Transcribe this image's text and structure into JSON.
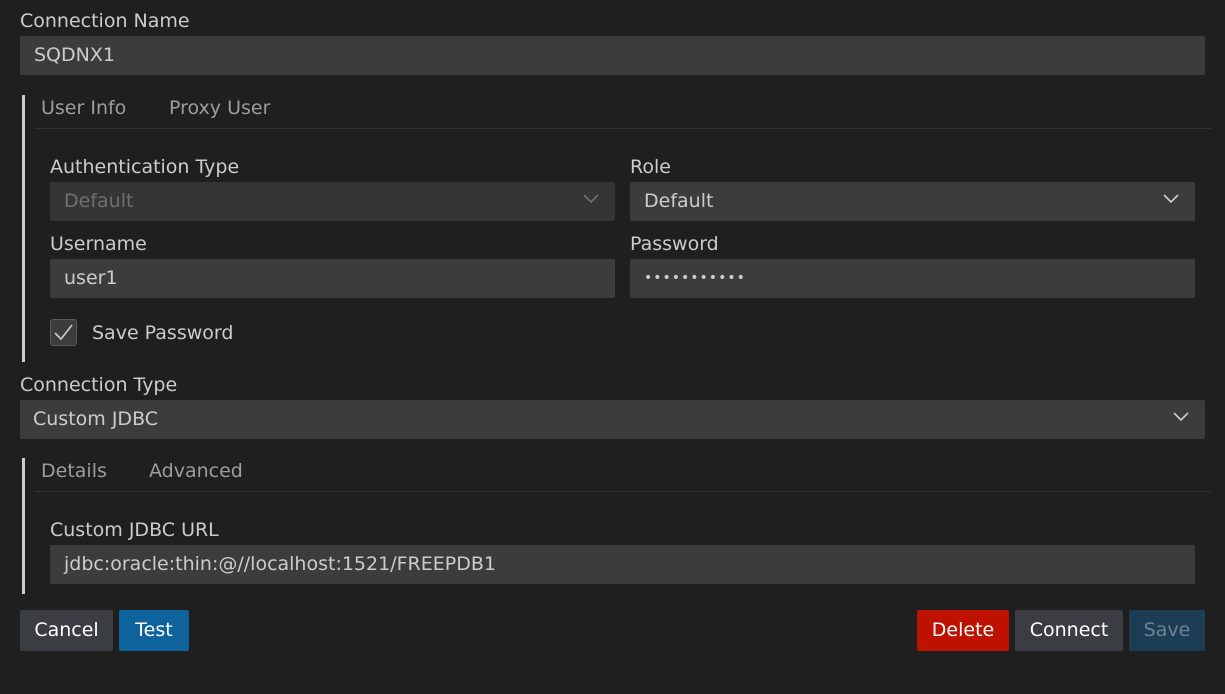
{
  "connection_name": {
    "label": "Connection Name",
    "value": "SQDNX1"
  },
  "user_section": {
    "tabs": [
      {
        "label": "User Info"
      },
      {
        "label": "Proxy User"
      }
    ],
    "auth_type": {
      "label": "Authentication Type",
      "value": "Default",
      "disabled": true
    },
    "role": {
      "label": "Role",
      "value": "Default"
    },
    "username": {
      "label": "Username",
      "value": "user1"
    },
    "password": {
      "label": "Password",
      "value": "•••••••••••"
    },
    "save_password": {
      "label": "Save Password",
      "checked": true
    }
  },
  "connection_type": {
    "label": "Connection Type",
    "value": "Custom JDBC"
  },
  "details_section": {
    "tabs": [
      {
        "label": "Details"
      },
      {
        "label": "Advanced"
      }
    ],
    "jdbc_url": {
      "label": "Custom JDBC URL",
      "value": "jdbc:oracle:thin:@//localhost:1521/FREEPDB1"
    }
  },
  "buttons": {
    "cancel": "Cancel",
    "test": "Test",
    "delete": "Delete",
    "connect": "Connect",
    "save": "Save"
  },
  "colors": {
    "background": "#1f1f1f",
    "input": "#3c3c3c",
    "primary": "#0e639c",
    "danger": "#be1100",
    "secondary": "#3a3d41",
    "disabled_primary": "#1c3d53"
  }
}
